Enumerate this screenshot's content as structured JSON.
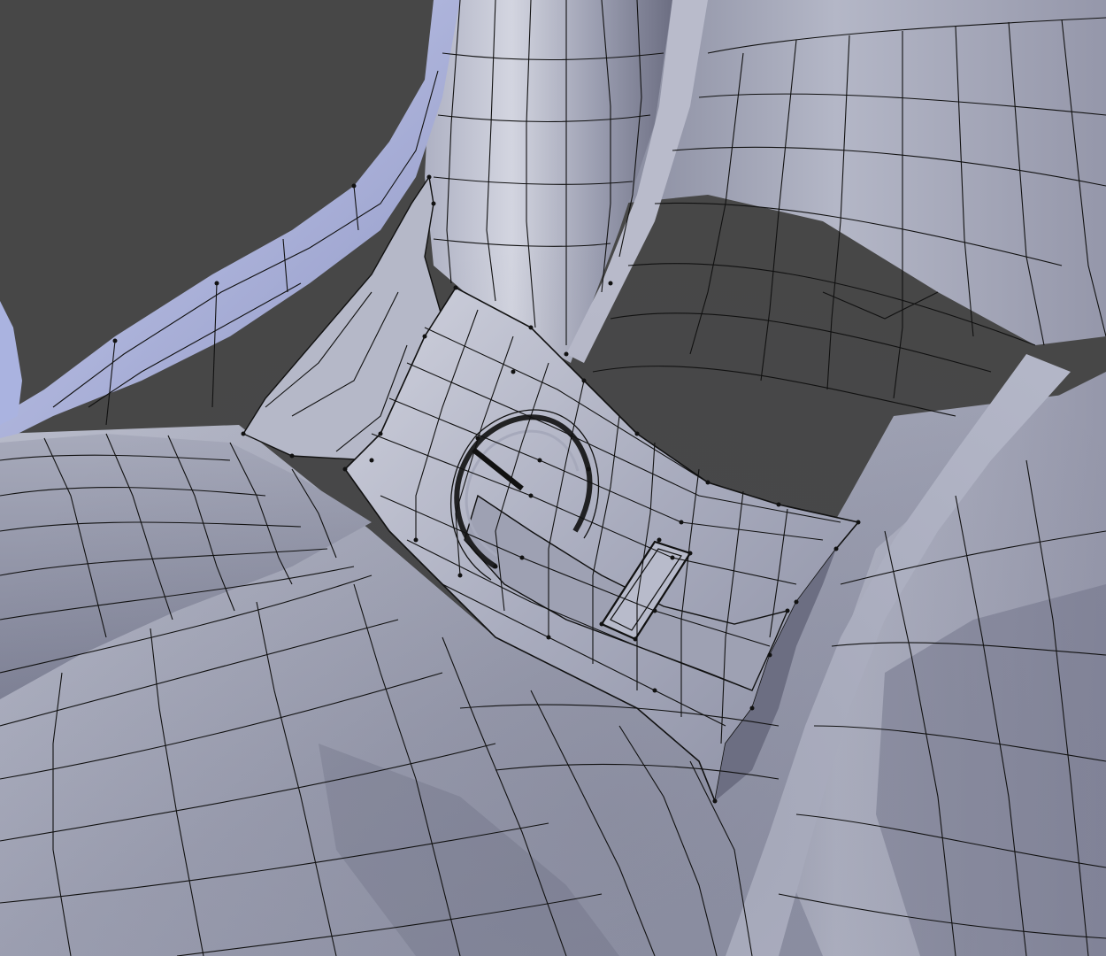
{
  "viewport": {
    "mode": "3d-viewport",
    "shading": "solid",
    "overlay": "wireframe-edges",
    "selected_object": "shoe-strap-buckle"
  },
  "colors": {
    "background": "#474747",
    "mesh_base": "#9a9db0",
    "mesh_light": "#c4c6d6",
    "mesh_rim": "#aeb6e2",
    "mesh_dark": "#55566a",
    "wire": "#111111"
  },
  "labels": {}
}
